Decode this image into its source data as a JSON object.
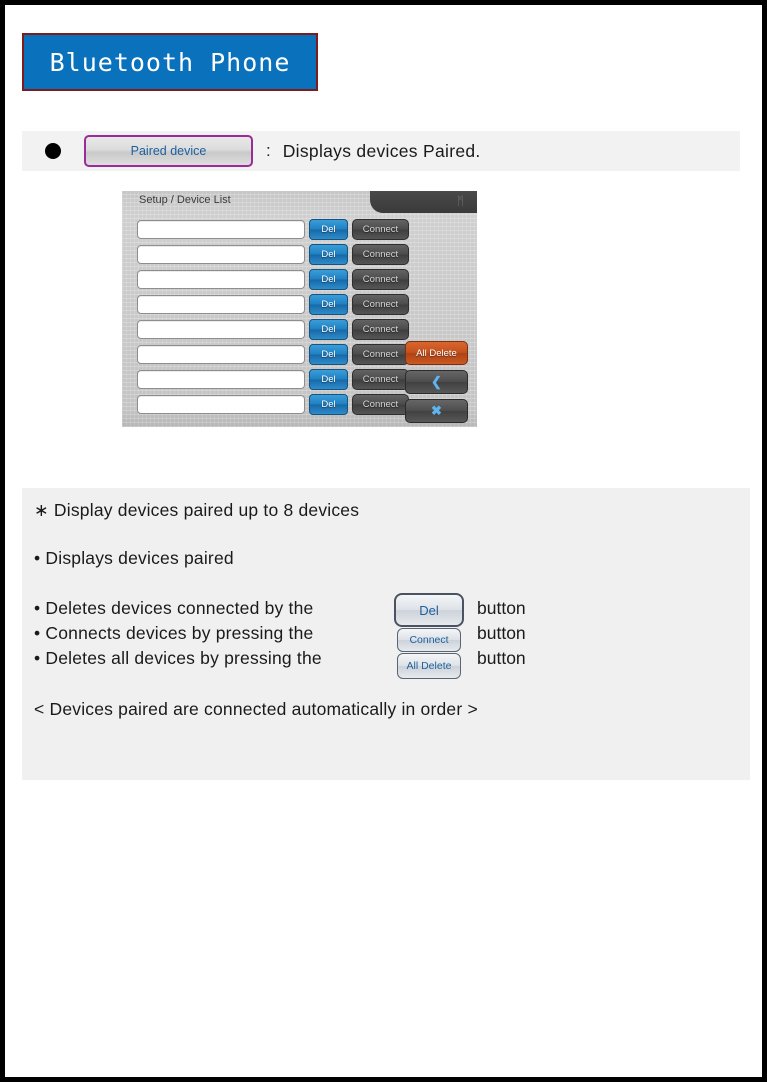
{
  "page": {
    "title_banner": "Bluetooth Phone"
  },
  "header": {
    "bullet": "●",
    "chip_label": "Paired device",
    "separator": ":",
    "description": "Displays devices Paired."
  },
  "device_screen": {
    "screen_title": "Setup / Device List",
    "bluetooth_icon": "ᛗ",
    "row_count": 8,
    "rows": [
      {
        "name": "",
        "del_label": "Del",
        "connect_label": "Connect"
      },
      {
        "name": "",
        "del_label": "Del",
        "connect_label": "Connect"
      },
      {
        "name": "",
        "del_label": "Del",
        "connect_label": "Connect"
      },
      {
        "name": "",
        "del_label": "Del",
        "connect_label": "Connect"
      },
      {
        "name": "",
        "del_label": "Del",
        "connect_label": "Connect"
      },
      {
        "name": "",
        "del_label": "Del",
        "connect_label": "Connect"
      },
      {
        "name": "",
        "del_label": "Del",
        "connect_label": "Connect"
      },
      {
        "name": "",
        "del_label": "Del",
        "connect_label": "Connect"
      }
    ],
    "actions": {
      "all_delete": "All Delete",
      "back": "❮",
      "close": "✖"
    },
    "colors": {
      "del_button": "#2080c2",
      "connect_button": "#4c4c4c",
      "all_delete_button": "#c4501d",
      "action_icon": "#5fb4ef"
    }
  },
  "description": {
    "star_line": "∗ Display devices paired up to 8 devices",
    "bullet_1": "• Displays devices paired",
    "bullet_2": "• Deletes devices connected by the",
    "bullet_3": "• Connects devices by pressing the",
    "bullet_4": "• Deletes all devices by pressing the",
    "word_button_1": "button",
    "word_button_2": "button",
    "word_button_3": "button",
    "note": "< Devices paired are connected automatically in order >",
    "inline_buttons": {
      "del": "Del",
      "connect": "Connect",
      "all_delete": "All Delete"
    }
  }
}
